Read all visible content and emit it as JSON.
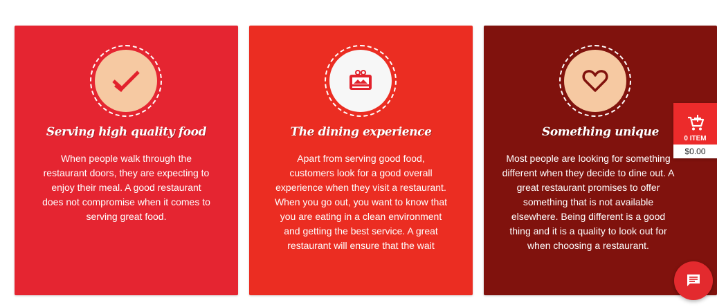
{
  "colors": {
    "card_1": "#e52531",
    "card_2": "#eb2d22",
    "card_3": "#80120d",
    "disc_peach": "#f6c9a2",
    "disc_white": "#f7f7f7",
    "icon_red": "#e2222c",
    "icon_dark": "#80120d",
    "cart_red": "#ec2b2b",
    "chat_red": "#e32a2e"
  },
  "cards": [
    {
      "icon": "check-icon",
      "title": "Serving high quality food",
      "text": "When people walk through the restaurant doors, they are expecting to enjoy their meal. A good restaurant does not compromise when it comes to serving great food."
    },
    {
      "icon": "dining-icon",
      "title": "The dining experience",
      "text": "Apart from serving good food, customers look for a good overall experience when they visit a restaurant. When you go out, you want to know that you are eating in a clean environment and getting the best service. A great restaurant will ensure that the wait"
    },
    {
      "icon": "heart-icon",
      "title": "Something unique",
      "text": "Most people are looking for something different when they decide to dine out. A great restaurant promises to offer something that is not available elsewhere. Being different is a good thing and it is a quality to look out for when choosing a restaurant."
    }
  ],
  "cart": {
    "icon": "add-to-cart-icon",
    "count_label": "0 ITEM",
    "total": "$0.00"
  },
  "chat": {
    "icon": "chat-icon"
  }
}
